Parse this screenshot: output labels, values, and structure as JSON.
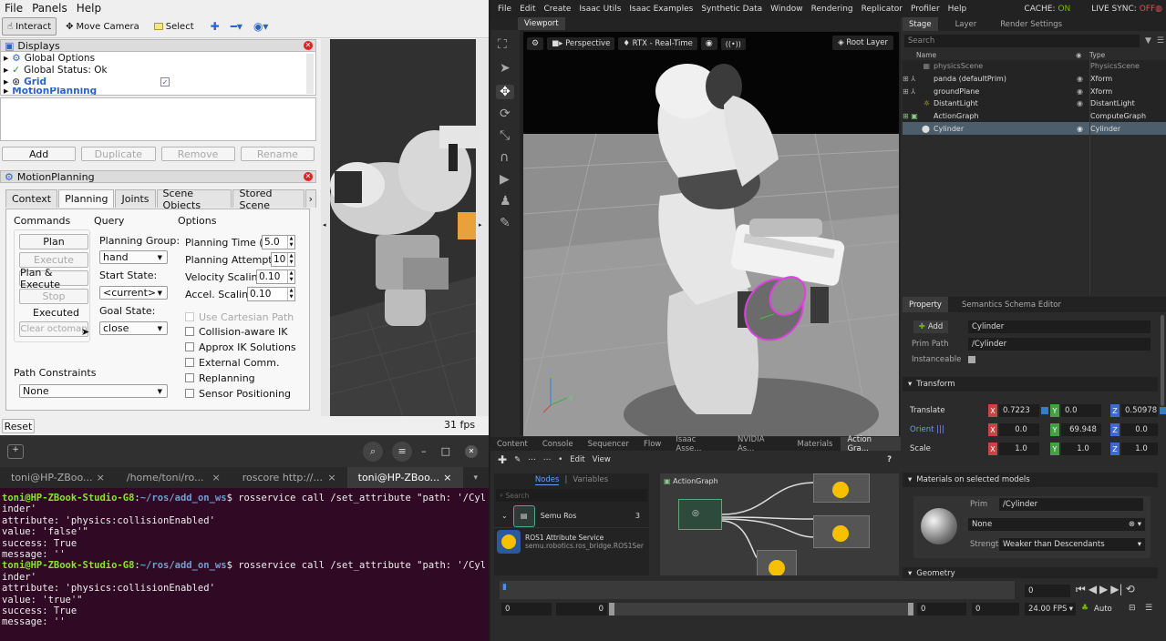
{
  "rviz": {
    "menu": [
      "File",
      "Panels",
      "Help"
    ],
    "toolbar": {
      "interact": "Interact",
      "move_camera": "Move Camera",
      "select": "Select"
    },
    "displays": {
      "title": "Displays",
      "items": [
        "Global Options",
        "Global Status: Ok",
        "Grid",
        "MotionPlanning"
      ],
      "buttons": {
        "add": "Add",
        "duplicate": "Duplicate",
        "remove": "Remove",
        "rename": "Rename"
      }
    },
    "motion": {
      "title": "MotionPlanning",
      "tabs": [
        "Context",
        "Planning",
        "Joints",
        "Scene Objects",
        "Stored Scene"
      ],
      "commands_label": "Commands",
      "query_label": "Query",
      "options_label": "Options",
      "commands": {
        "plan": "Plan",
        "execute": "Execute",
        "plan_execute": "Plan & Execute",
        "stop": "Stop",
        "status": "Executed",
        "clear": "Clear octomap"
      },
      "planning_group_label": "Planning Group:",
      "planning_group": "hand",
      "start_state_label": "Start State:",
      "start_state": "<current>",
      "goal_state_label": "Goal State:",
      "goal_state": "close",
      "options": {
        "planning_time_label": "Planning Time (s):",
        "planning_time": "5.0",
        "planning_attempts_label": "Planning Attempts:",
        "planning_attempts": "10",
        "velocity_label": "Velocity Scaling:",
        "velocity": "0.10",
        "accel_label": "Accel. Scaling:",
        "accel": "0.10"
      },
      "checkboxes": [
        "Use Cartesian Path",
        "Collision-aware IK",
        "Approx IK Solutions",
        "External Comm.",
        "Replanning",
        "Sensor Positioning"
      ],
      "path_constraints_label": "Path Constraints",
      "path_constraints": "None"
    },
    "reset": "Reset",
    "fps": "31 fps"
  },
  "terminal": {
    "tabs": [
      "toni@HP-ZBoo...",
      "/home/toni/ro...",
      "roscore http://...",
      "toni@HP-ZBoo..."
    ],
    "prompt_user": "toni@HP-ZBook-Studio-G8",
    "prompt_path": "~/ros/add_on_ws",
    "command": "rosservice call /set_attribute \"path: '/Cyl",
    "block1": [
      "inder'",
      "attribute: 'physics:collisionEnabled'",
      "value: 'false'\"",
      "success: True",
      "message: ''"
    ],
    "block2": [
      "inder'",
      "attribute: 'physics:collisionEnabled'",
      "value: 'true'\"",
      "success: True",
      "message: ''"
    ]
  },
  "isaac": {
    "menu": [
      "File",
      "Edit",
      "Create",
      "Isaac Utils",
      "Isaac Examples",
      "Synthetic Data",
      "Window",
      "Rendering",
      "Replicator",
      "Profiler",
      "Help"
    ],
    "cache": "CACHE:",
    "cache_state": "ON",
    "live_sync": "LIVE SYNC:",
    "live_state": "OFF",
    "viewport_tab": "Viewport",
    "viewport_bar": {
      "perspective": "Perspective",
      "rtx": "RTX - Real-Time",
      "root_layer": "Root Layer"
    },
    "stage": {
      "tabs": [
        "Stage",
        "Layer",
        "Render Settings"
      ],
      "search": "Search",
      "col_name": "Name",
      "col_type": "Type",
      "rows": [
        {
          "name": "physicsScene",
          "type": "PhysicsScene"
        },
        {
          "name": "panda (defaultPrim)",
          "type": "Xform"
        },
        {
          "name": "groundPlane",
          "type": "Xform"
        },
        {
          "name": "DistantLight",
          "type": "DistantLight"
        },
        {
          "name": "ActionGraph",
          "type": "ComputeGraph"
        },
        {
          "name": "Cylinder",
          "type": "Cylinder"
        }
      ]
    },
    "property": {
      "tabs": [
        "Property",
        "Semantics Schema Editor"
      ],
      "add": "Add",
      "name": "Cylinder",
      "prim_path_label": "Prim Path",
      "prim_path": "/Cylinder",
      "instanceable_label": "Instanceable",
      "transform": "Transform",
      "translate_label": "Translate",
      "translate": [
        "0.7223",
        "0.0",
        "0.50978"
      ],
      "orient_label": "Orient",
      "orient": [
        "0.0",
        "69.948",
        "0.0"
      ],
      "scale_label": "Scale",
      "scale": [
        "1.0",
        "1.0",
        "1.0"
      ],
      "materials": "Materials on selected models",
      "prim_label": "Prim",
      "prim": "/Cylinder",
      "material": "None",
      "strength_label": "Strength",
      "strength": "Weaker than Descendants",
      "geometry": "Geometry"
    },
    "bottom_tabs": [
      "Content",
      "Console",
      "Sequencer",
      "Flow",
      "Isaac Asse...",
      "NVIDIA As...",
      "Materials",
      "Action Gra..."
    ],
    "graph": {
      "edit": "Edit",
      "view": "View",
      "nodes": "Nodes",
      "variables": "Variables",
      "search": "Search",
      "category": "Semu Ros",
      "count": "3",
      "item_title": "ROS1 Attribute Service",
      "item_sub": "semu.robotics.ros_bridge.ROS1Ser",
      "graph_name": "ActionGraph"
    },
    "timeline": {
      "start": "0",
      "start2": "0",
      "end": "0",
      "end2": "0",
      "current": "0",
      "fps": "24.00 FPS",
      "auto": "Auto"
    },
    "accent": "#76b900"
  }
}
